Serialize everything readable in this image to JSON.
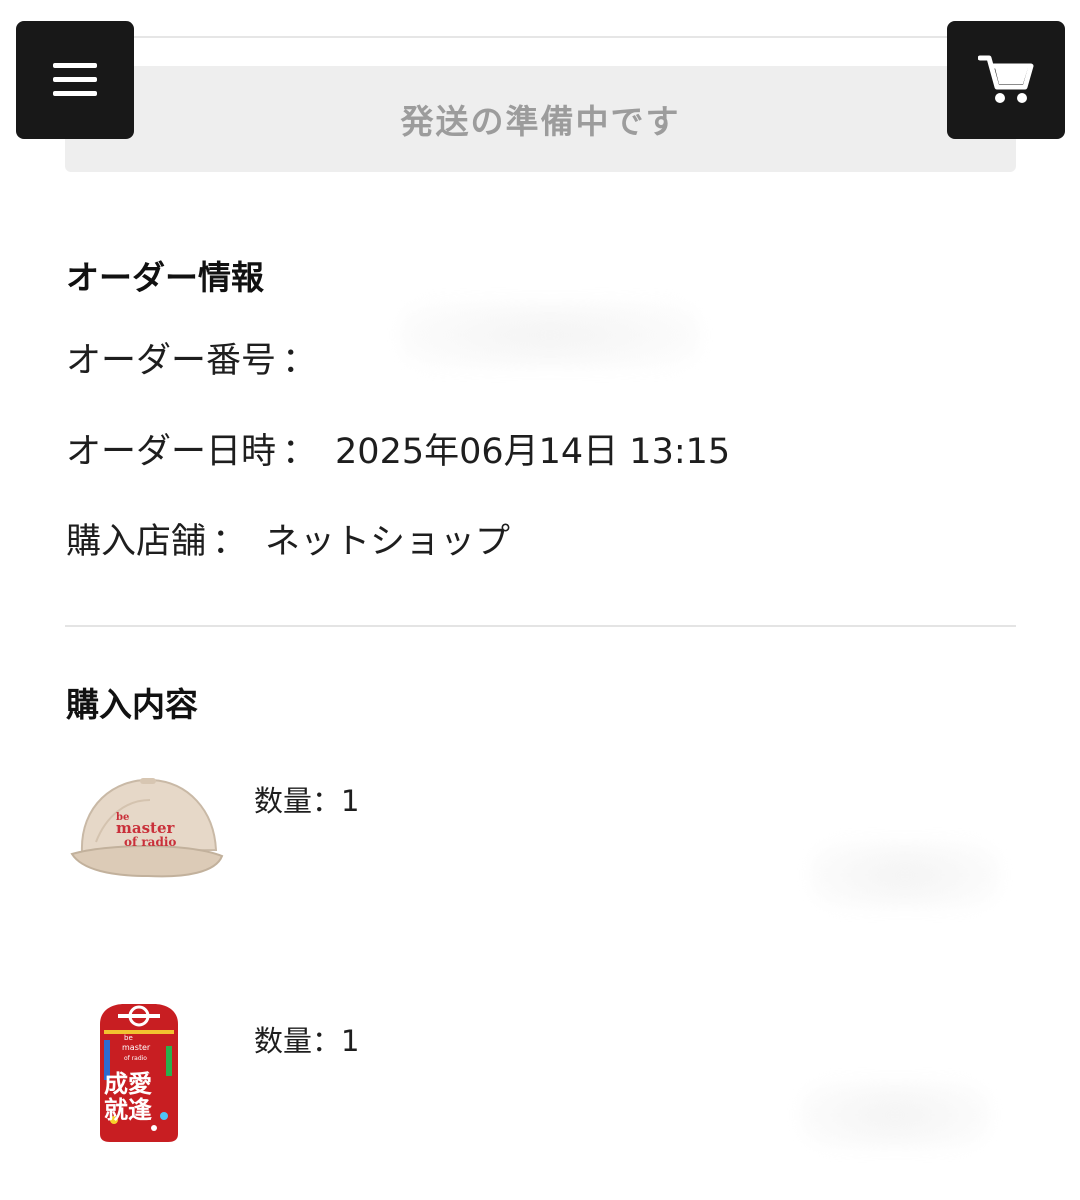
{
  "status": {
    "text": "発送の準備中です"
  },
  "order_info": {
    "title": "オーダー情報",
    "order_number": {
      "label": "オーダー番号",
      "separator": "：",
      "value": ""
    },
    "order_datetime": {
      "label": "オーダー日時",
      "separator": "：",
      "value": "2025年06月14日 13:15"
    },
    "store": {
      "label": "購入店舗",
      "separator": "：",
      "value": "ネットショップ"
    }
  },
  "purchase": {
    "title": "購入内容",
    "items": [
      {
        "quantity_label": "数量：",
        "quantity": "1",
        "thumbnail": "cap-image",
        "thumbnail_text": [
          "be",
          "master",
          "of radio"
        ]
      },
      {
        "quantity_label": "数量：",
        "quantity": "1",
        "thumbnail": "omamori-image",
        "thumbnail_text": [
          "be",
          "master",
          "of radio",
          "成愛",
          "就逢"
        ]
      }
    ]
  },
  "icons": {
    "menu": "hamburger-menu-icon",
    "cart": "cart-icon"
  },
  "colors": {
    "fab_bg": "#181818",
    "status_bg": "#eeeeee",
    "status_text": "#9c9c9c"
  }
}
